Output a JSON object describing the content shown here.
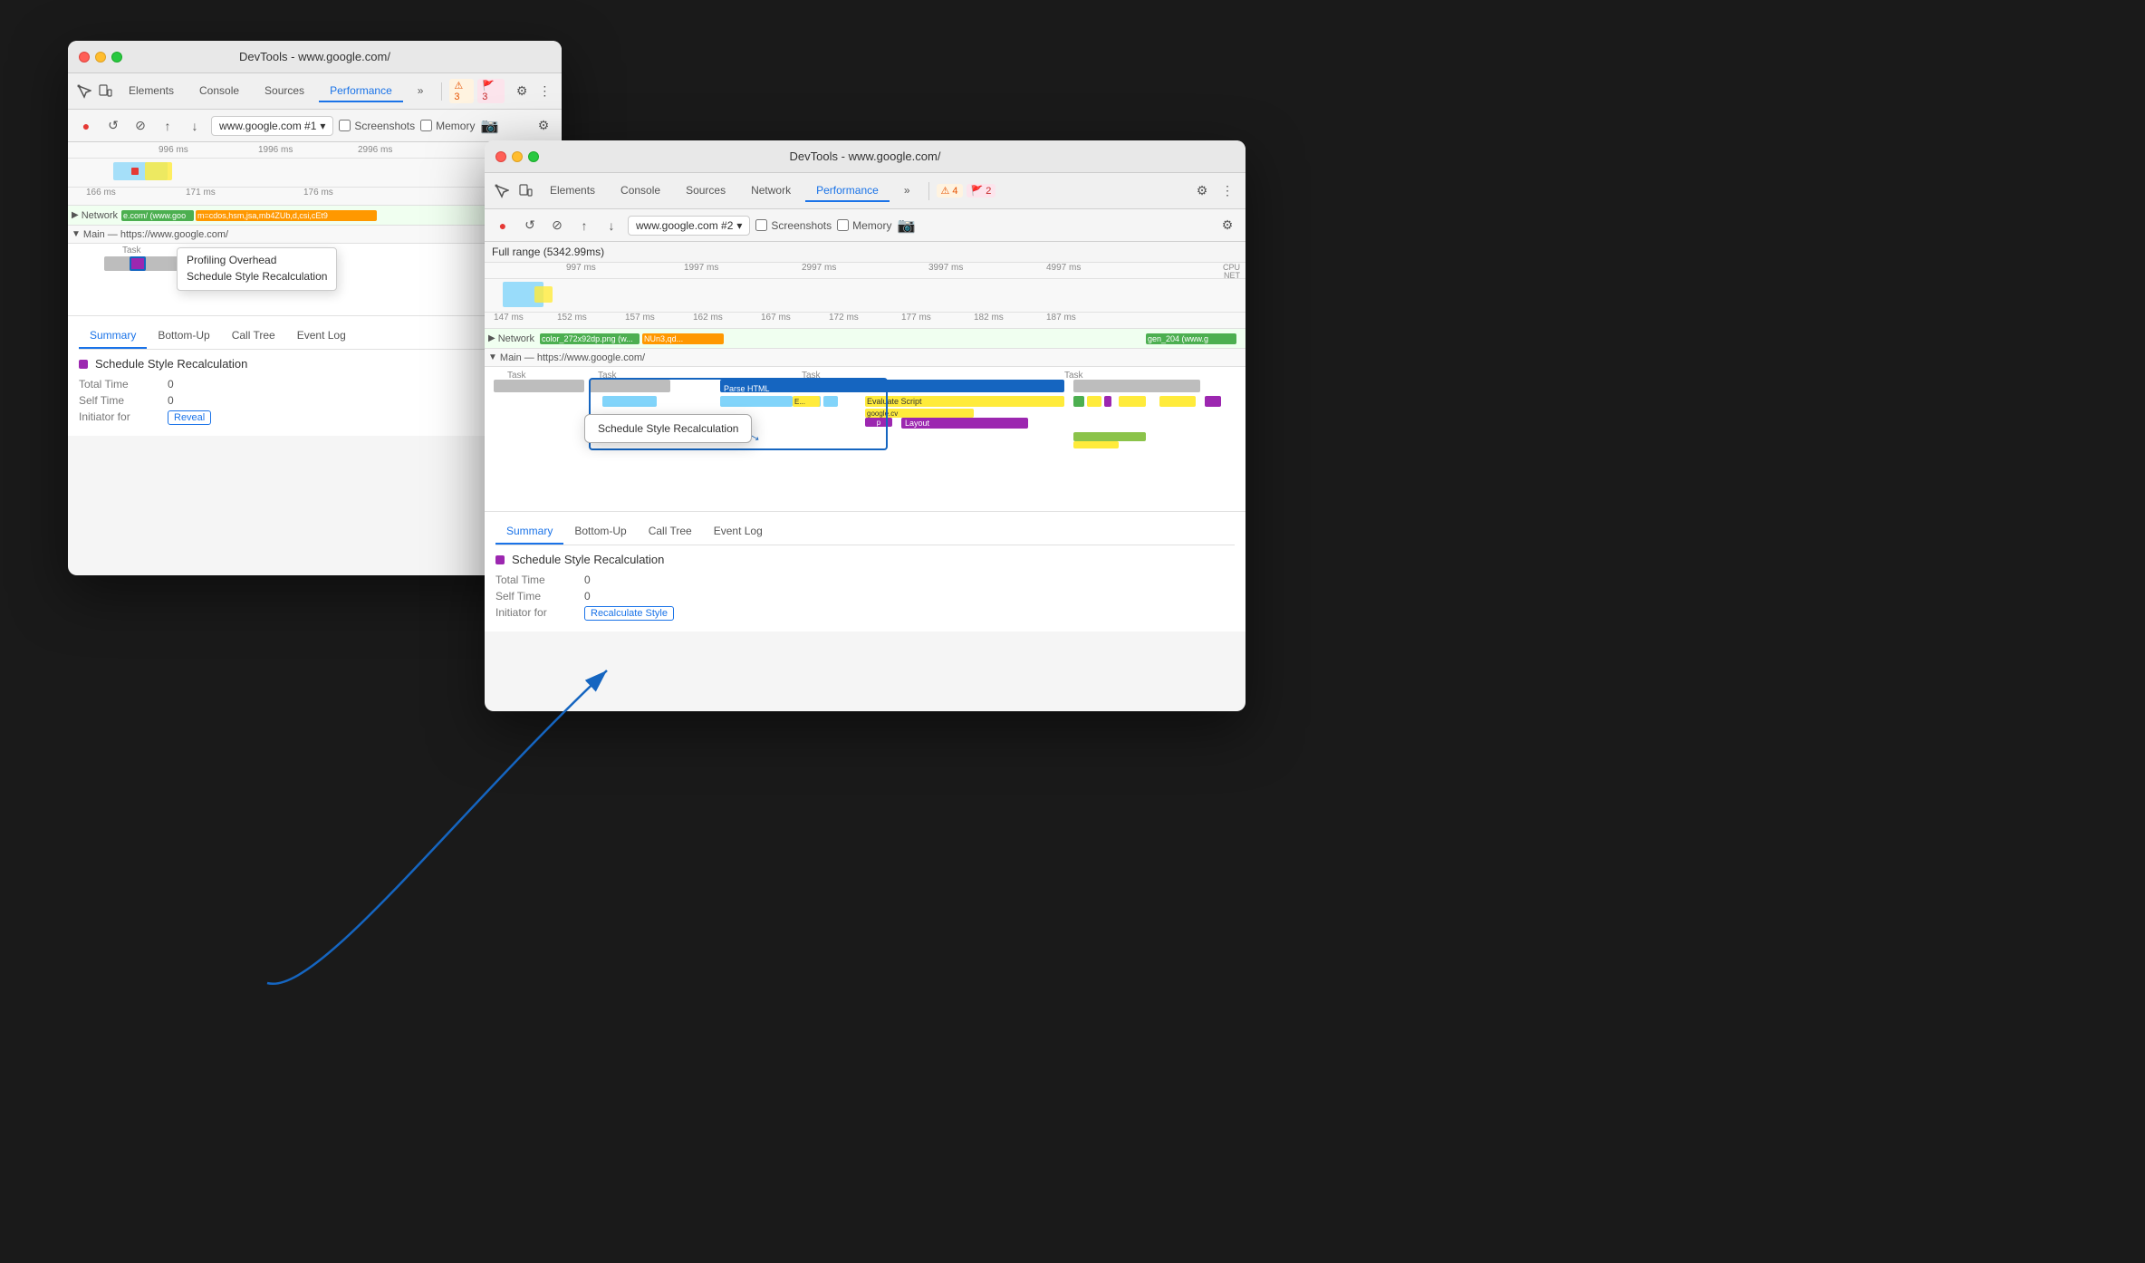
{
  "window1": {
    "title": "DevTools - www.google.com/",
    "tabs": {
      "items": [
        "Elements",
        "Console",
        "Sources",
        "Performance",
        "»"
      ]
    },
    "badges": {
      "warn": "⚠ 3",
      "err": "🚩 3"
    },
    "perf_toolbar": {
      "url": "www.google.com #1",
      "screenshots_label": "Screenshots",
      "memory_label": "Memory"
    },
    "ruler": {
      "marks": [
        "996 ms",
        "1996 ms",
        "2996 ms"
      ]
    },
    "detail_ruler": {
      "marks": [
        "166 ms",
        "171 ms",
        "176 ms"
      ]
    },
    "network_label": "Network",
    "network_url": "e.com/ (www.goo",
    "network_content": "m=cdos,hsm,jsa,mb4ZUb,d,csi,cEt9",
    "main_label": "Main — https://www.google.com/",
    "task_label": "Task",
    "profiling_overhead": "Profiling Overhead",
    "schedule_style": "Schedule Style Recalculation",
    "summary_tabs": [
      "Summary",
      "Bottom-Up",
      "Call Tree",
      "Event Log"
    ],
    "summary_title": "Schedule Style Recalculation",
    "total_time_label": "Total Time",
    "total_time_val": "0",
    "self_time_label": "Self Time",
    "self_time_val": "0",
    "initiator_label": "Initiator for",
    "reveal_label": "Reveal"
  },
  "window2": {
    "title": "DevTools - www.google.com/",
    "tabs": {
      "items": [
        "Elements",
        "Console",
        "Sources",
        "Network",
        "Performance",
        "»"
      ]
    },
    "badges": {
      "warn": "⚠ 4",
      "err": "🚩 2"
    },
    "perf_toolbar": {
      "url": "www.google.com #2",
      "screenshots_label": "Screenshots",
      "memory_label": "Memory"
    },
    "full_range": "Full range (5342.99ms)",
    "ruler": {
      "marks": [
        "997 ms",
        "1997 ms",
        "2997 ms",
        "3997 ms",
        "4997 ms"
      ]
    },
    "side_labels": [
      "CPU",
      "NET"
    ],
    "detail_ruler": {
      "marks": [
        "147 ms",
        "152 ms",
        "157 ms",
        "162 ms",
        "167 ms",
        "172 ms",
        "177 ms",
        "182 ms",
        "187 ms"
      ]
    },
    "network_label": "Network",
    "network_content1": "color_272x92dp.png (w...",
    "network_content2": "NUn3,qd...",
    "network_content3": "gen_204 (www.g",
    "main_label": "Main — https://www.google.com/",
    "task_label": "Task",
    "parse_html_label": "Parse HTML",
    "evaluate_label": "E...",
    "evaluate_full": "Evaluate Script",
    "google_cv": "google.cv",
    "p_label": "p",
    "layout_label": "Layout",
    "schedule_style_popup": "Schedule Style Recalculation",
    "summary_tabs": [
      "Summary",
      "Bottom-Up",
      "Call Tree",
      "Event Log"
    ],
    "summary_title": "Schedule Style Recalculation",
    "total_time_label": "Total Time",
    "total_time_val": "0",
    "self_time_label": "Self Time",
    "self_time_val": "0",
    "initiator_label": "Initiator for",
    "recalculate_label": "Recalculate Style"
  }
}
